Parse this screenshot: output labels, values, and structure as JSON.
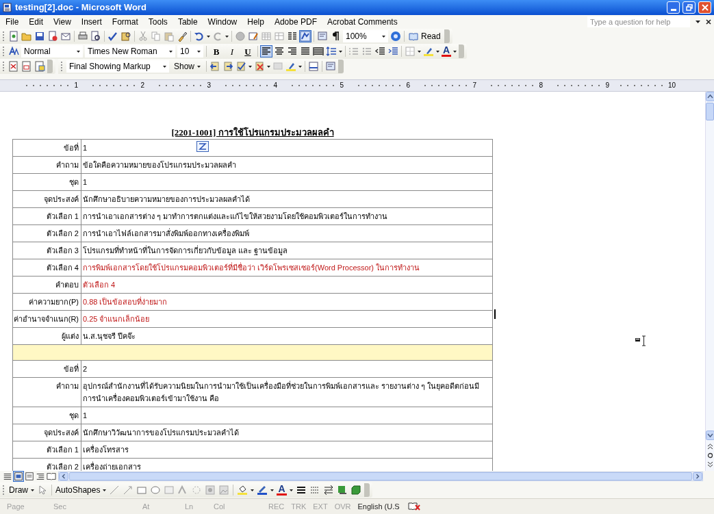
{
  "window": {
    "title": "testing[2].doc - Microsoft Word"
  },
  "menu": [
    "File",
    "Edit",
    "View",
    "Insert",
    "Format",
    "Tools",
    "Table",
    "Window",
    "Help",
    "Adobe PDF",
    "Acrobat Comments"
  ],
  "help_box": {
    "placeholder": "Type a question for help"
  },
  "standard_toolbar": {
    "zoom": "100%",
    "read_button": "Read",
    "document_map_selected": true
  },
  "formatting_toolbar": {
    "style": "Normal",
    "font": "Times New Roman",
    "size": "10",
    "text_buttons": [
      {
        "label": "B",
        "selected": false
      },
      {
        "label": "I",
        "selected": false
      },
      {
        "label": "U",
        "selected": false
      }
    ],
    "alignment": [
      {
        "kind": "left",
        "selected": true
      },
      {
        "kind": "center",
        "selected": false
      },
      {
        "kind": "right",
        "selected": false
      },
      {
        "kind": "justify",
        "selected": false
      },
      {
        "kind": "distributed",
        "selected": false
      }
    ],
    "font_color_label": "A"
  },
  "reviewing_toolbar": {
    "display": "Final Showing Markup",
    "show_button": "Show"
  },
  "ruler": [
    "1",
    "2",
    "3",
    "4",
    "5",
    "6",
    "7",
    "8",
    "9",
    "10"
  ],
  "document": {
    "heading": "[2201-1001] การใช้โปรแกรมประมวลผลคำ",
    "rows": [
      {
        "kind": "plain",
        "label": "ข้อที่",
        "value": "1",
        "comment_icon": true
      },
      {
        "kind": "plain",
        "label": "คำถาม",
        "value": "ข้อใดคือความหมายของโปรแกรมประมวลผลคำ"
      },
      {
        "kind": "plain",
        "label": "ชุด",
        "value": "1"
      },
      {
        "kind": "plain",
        "label": "จุดประสงค์",
        "value": "นักศึกษาอธิบายความหมายของการประมวลผลคำได้"
      },
      {
        "kind": "plain",
        "label": "ตัวเลือก 1",
        "value": "การนำเอาเอกสารต่าง ๆ มาทำการตกแต่งและแก้ไขให้สวยงามโดยใช้คอมพิวเตอร์ในการทำงาน"
      },
      {
        "kind": "plain",
        "label": "ตัวเลือก 2",
        "value": "การนำเอาไฟล์เอกสารมาสั่งพิมพ์ออกทางเครื่องพิมพ์"
      },
      {
        "kind": "plain",
        "label": "ตัวเลือก 3",
        "value": "โปรแกรมที่ทำหน้าที่ในการจัดการเกี่ยวกับข้อมูล และ ฐานข้อมูล"
      },
      {
        "kind": "key",
        "label": "ตัวเลือก 4",
        "value": "การพิมพ์เอกสารโดยใช้โปรแกรมคอมพิวเตอร์ที่มีชื่อว่า เวิร์ดโพรเซสเซอร์(Word Processor) ในการทำงาน"
      },
      {
        "kind": "key",
        "label": "คำตอบ",
        "value": "ตัวเลือก 4"
      },
      {
        "kind": "key",
        "label": "ค่าความยาก(P)",
        "value": "0.88  เป็นข้อสอบที่ง่ายมาก"
      },
      {
        "kind": "key",
        "label": "ค่าอำนาจจำแนก(R)",
        "value": "0.25  จำแนกเล็กน้อย"
      },
      {
        "kind": "plain",
        "label": "ผู้แต่ง",
        "value": "น.ส.นุชจรี ปีคจ๊ะ"
      },
      {
        "kind": "separator"
      },
      {
        "kind": "plain",
        "label": "ข้อที่",
        "value": "2"
      },
      {
        "kind": "plain",
        "label": "คำถาม",
        "value": "อุปกรณ์สำนักงานที่ได้รับความนิยมในการนำมาใช้เป็นเครื่องมือที่ช่วยในการพิมพ์เอกสารและ รายงานต่าง ๆ ในยุคอดีตก่อนมีการนำเครื่องคอมพิวเตอร์เข้ามาใช้งาน คือ"
      },
      {
        "kind": "plain",
        "label": "ชุด",
        "value": "1"
      },
      {
        "kind": "plain",
        "label": "จุดประสงค์",
        "value": "นักศึกษาวิวัฒนาการของโปรแกรมประมวลคำได้"
      },
      {
        "kind": "plain",
        "label": "ตัวเลือก 1",
        "value": "เครื่องโทรสาร"
      },
      {
        "kind": "plain",
        "label": "ตัวเลือก 2",
        "value": "เครื่องถ่ายเอกสาร"
      }
    ]
  },
  "view_buttons": [
    {
      "kind": "normal",
      "selected": false
    },
    {
      "kind": "web",
      "selected": true
    },
    {
      "kind": "print",
      "selected": false
    },
    {
      "kind": "outline",
      "selected": false
    },
    {
      "kind": "reading",
      "selected": false
    }
  ],
  "drawing_toolbar": {
    "draw": "Draw",
    "autoshapes": "AutoShapes",
    "font_color_label": "A"
  },
  "status_bar": [
    {
      "text": "Page",
      "disabled": true
    },
    {
      "text": "Sec",
      "disabled": true
    },
    {
      "text": "At",
      "disabled": true
    },
    {
      "text": "Ln",
      "disabled": true
    },
    {
      "text": "Col",
      "disabled": true
    },
    {
      "text": "REC",
      "disabled": true
    },
    {
      "text": "TRK",
      "disabled": true
    },
    {
      "text": "EXT",
      "disabled": true
    },
    {
      "text": "OVR",
      "disabled": true
    },
    {
      "text": "English (U.S",
      "disabled": false
    }
  ]
}
